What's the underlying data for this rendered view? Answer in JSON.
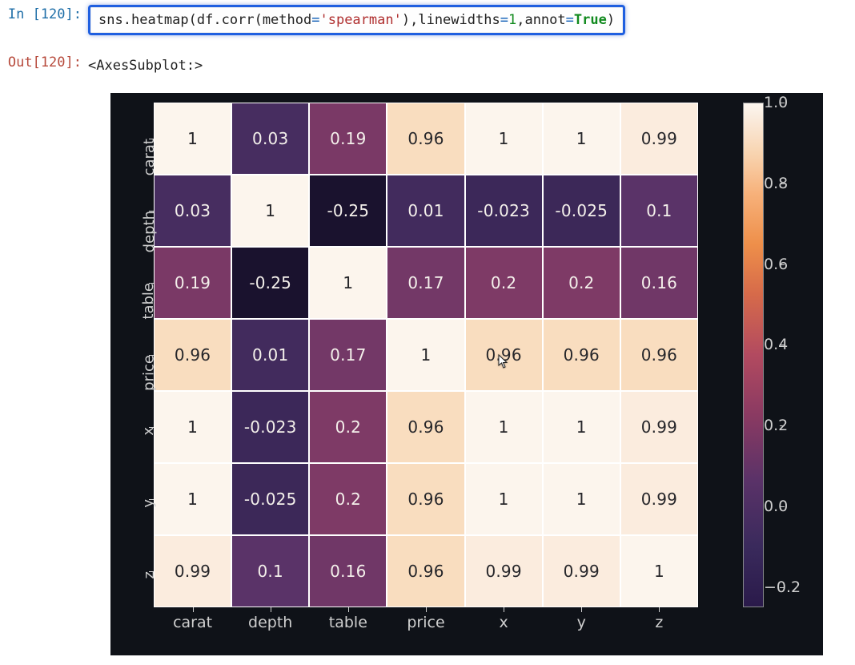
{
  "input_prompt": "In [120]:",
  "output_prompt": "Out[120]:",
  "code_tokens": [
    {
      "t": "sns",
      "c": "tok-call"
    },
    {
      "t": ".",
      "c": "tok-call"
    },
    {
      "t": "heatmap",
      "c": "tok-call"
    },
    {
      "t": "(",
      "c": "tok-call"
    },
    {
      "t": "df",
      "c": "tok-call"
    },
    {
      "t": ".",
      "c": "tok-call"
    },
    {
      "t": "corr",
      "c": "tok-call"
    },
    {
      "t": "(",
      "c": "tok-call"
    },
    {
      "t": "method",
      "c": "tok-call"
    },
    {
      "t": "=",
      "c": "tok-kw"
    },
    {
      "t": "'spearman'",
      "c": "tok-str"
    },
    {
      "t": ")",
      "c": "tok-call"
    },
    {
      "t": ",",
      "c": "tok-call"
    },
    {
      "t": "linewidths",
      "c": "tok-call"
    },
    {
      "t": "=",
      "c": "tok-kw"
    },
    {
      "t": "1",
      "c": "tok-num"
    },
    {
      "t": ",",
      "c": "tok-call"
    },
    {
      "t": "annot",
      "c": "tok-call"
    },
    {
      "t": "=",
      "c": "tok-kw"
    },
    {
      "t": "True",
      "c": "tok-bool"
    },
    {
      "t": ")",
      "c": "tok-call"
    }
  ],
  "output_text": "<AxesSubplot:>",
  "chart_data": {
    "type": "heatmap",
    "title": "",
    "xlabel": "",
    "ylabel": "",
    "x_categories": [
      "carat",
      "depth",
      "table",
      "price",
      "x",
      "y",
      "z"
    ],
    "y_categories": [
      "carat",
      "depth",
      "table",
      "price",
      "x",
      "y",
      "z"
    ],
    "values": [
      [
        1,
        0.03,
        0.19,
        0.96,
        1,
        1,
        0.99
      ],
      [
        0.03,
        1,
        -0.25,
        0.01,
        -0.023,
        -0.025,
        0.1
      ],
      [
        0.19,
        -0.25,
        1,
        0.17,
        0.2,
        0.2,
        0.16
      ],
      [
        0.96,
        0.01,
        0.17,
        1,
        0.96,
        0.96,
        0.96
      ],
      [
        1,
        -0.023,
        0.2,
        0.96,
        1,
        1,
        0.99
      ],
      [
        1,
        -0.025,
        0.2,
        0.96,
        1,
        1,
        0.99
      ],
      [
        0.99,
        0.1,
        0.16,
        0.96,
        0.99,
        0.99,
        1
      ]
    ],
    "annot_text": [
      [
        "1",
        "0.03",
        "0.19",
        "0.96",
        "1",
        "1",
        "0.99"
      ],
      [
        "0.03",
        "1",
        "-0.25",
        "0.01",
        "-0.023",
        "-0.025",
        "0.1"
      ],
      [
        "0.19",
        "-0.25",
        "1",
        "0.17",
        "0.2",
        "0.2",
        "0.16"
      ],
      [
        "0.96",
        "0.01",
        "0.17",
        "1",
        "0.96",
        "0.96",
        "0.96"
      ],
      [
        "1",
        "-0.023",
        "0.2",
        "0.96",
        "1",
        "1",
        "0.99"
      ],
      [
        "1",
        "-0.025",
        "0.2",
        "0.96",
        "1",
        "1",
        "0.99"
      ],
      [
        "0.99",
        "0.1",
        "0.16",
        "0.96",
        "0.99",
        "0.99",
        "1"
      ]
    ],
    "colorbar": {
      "ticks": [
        -0.2,
        0.0,
        0.2,
        0.4,
        0.6,
        0.8,
        1.0
      ],
      "vmin": -0.25,
      "vmax": 1.0
    }
  },
  "colormap_stops": [
    {
      "v": -0.25,
      "c": "#1a122e"
    },
    {
      "v": -0.15,
      "c": "#2a1c46"
    },
    {
      "v": 0.0,
      "c": "#3f2a5c"
    },
    {
      "v": 0.1,
      "c": "#5a3368"
    },
    {
      "v": 0.2,
      "c": "#7e3a66"
    },
    {
      "v": 0.3,
      "c": "#9c3e60"
    },
    {
      "v": 0.45,
      "c": "#bd4f55"
    },
    {
      "v": 0.6,
      "c": "#d66a4a"
    },
    {
      "v": 0.75,
      "c": "#ec8f55"
    },
    {
      "v": 0.88,
      "c": "#f4b784"
    },
    {
      "v": 0.95,
      "c": "#f8d8b6"
    },
    {
      "v": 0.985,
      "c": "#fae8d6"
    },
    {
      "v": 1.0,
      "c": "#fcf5ed"
    }
  ]
}
